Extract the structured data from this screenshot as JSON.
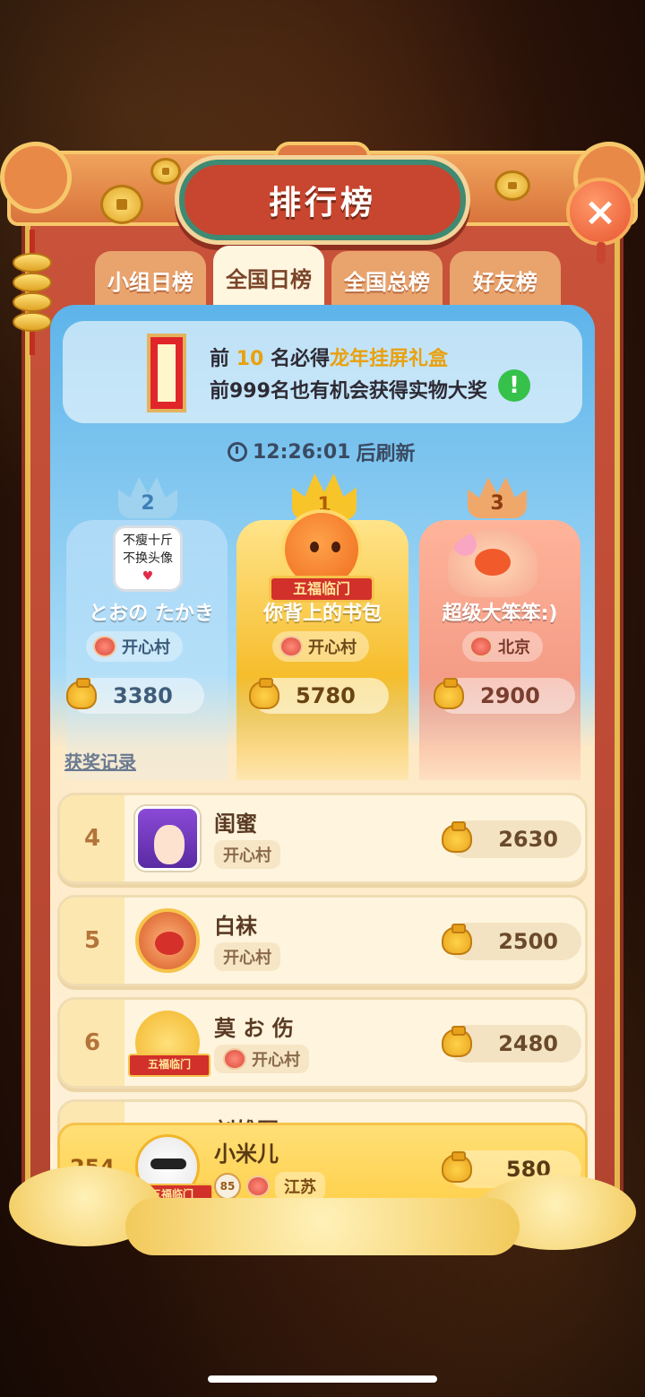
{
  "modal": {
    "title": "排行榜",
    "close_label": "×"
  },
  "tabs": [
    {
      "label": "小组日榜",
      "active": false
    },
    {
      "label": "全国日榜",
      "active": true
    },
    {
      "label": "全国总榜",
      "active": false
    },
    {
      "label": "好友榜",
      "active": false
    }
  ],
  "banner": {
    "line1_prefix": "前",
    "line1_number": "10",
    "line1_mid": "名必得",
    "line1_prize": "龙年挂屏礼盒",
    "line2": "前999名也有机会获得实物大奖",
    "info_icon": "!"
  },
  "timer": {
    "time": "12:26:01",
    "suffix": "后刷新"
  },
  "podium": [
    {
      "rank": "2",
      "name": "とおの たかき",
      "village": "开心村",
      "score": "3380",
      "avatar_line1": "不瘦十斤",
      "avatar_line2": "不换头像"
    },
    {
      "rank": "1",
      "name": "你背上的书包",
      "village": "开心村",
      "score": "5780",
      "badge": "五福临门"
    },
    {
      "rank": "3",
      "name": "超级大笨笨:)",
      "village": "北京",
      "score": "2900"
    }
  ],
  "award_link": "获奖记录",
  "rows": [
    {
      "rank": "4",
      "name": "闺蜜",
      "village": "开心村",
      "score": "2630"
    },
    {
      "rank": "5",
      "name": "白袜",
      "village": "开心村",
      "score": "2500"
    },
    {
      "rank": "6",
      "name": "莫 お 伤",
      "village": "开心村",
      "score": "2480"
    },
    {
      "rank": "",
      "name": "刘雄军",
      "village": "",
      "score": ""
    }
  ],
  "me": {
    "rank": "254",
    "name": "小米儿",
    "level": "85",
    "village": "江苏",
    "score": "580"
  },
  "colors": {
    "accent_gold": "#f6c24a",
    "frame_red": "#c9523a",
    "tab_active": "#fff6e0"
  }
}
